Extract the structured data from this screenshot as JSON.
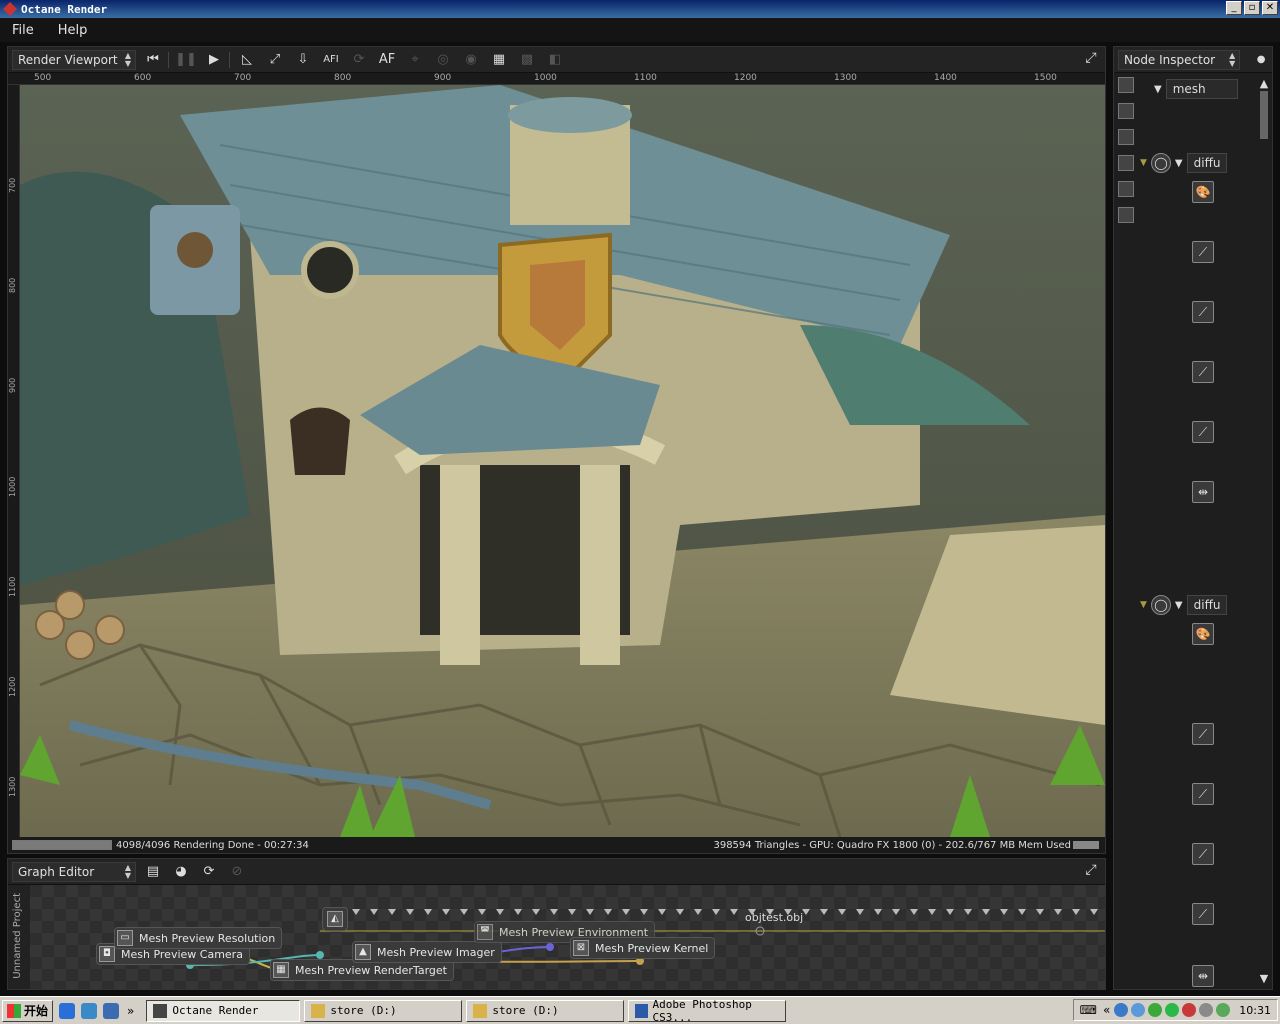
{
  "window": {
    "title": "Octane Render",
    "buttons": {
      "minimize": "_",
      "maximize": "▫",
      "close": "✕"
    }
  },
  "menubar": {
    "items": [
      "File",
      "Help"
    ]
  },
  "viewport": {
    "mode": "Render Viewport",
    "toolbar_af_label": "AF",
    "toolbar_afi_label": "AFI",
    "ruler_h": [
      "500",
      "600",
      "700",
      "800",
      "900",
      "1000",
      "1100",
      "1200",
      "1300",
      "1400",
      "1500"
    ],
    "ruler_v": [
      "700",
      "800",
      "900",
      "1000",
      "1100",
      "1200",
      "1300"
    ],
    "status_left": "4098/4096 Rendering Done - 00:27:34",
    "status_right": "398594 Triangles - GPU: Quadro FX 1800 (0) - 202.6/767 MB Mem Used",
    "progress": 1.0
  },
  "inspector": {
    "mode": "Node Inspector",
    "root_label": "mesh",
    "material_label_1": "diffu",
    "material_label_2": "diffu"
  },
  "graph": {
    "mode": "Graph Editor",
    "project_label": "Unnamed Project",
    "mesh_node": "objtest.obj",
    "nodes": {
      "resolution": "Mesh Preview Resolution",
      "camera": "Mesh Preview Camera",
      "rendertarget": "Mesh Preview RenderTarget",
      "imager": "Mesh Preview Imager",
      "environment": "Mesh Preview Environment",
      "kernel": "Mesh Preview Kernel"
    }
  },
  "taskbar": {
    "start_label": "开始",
    "ql_more": "»",
    "tasks": [
      "Octane Render",
      "store (D:)",
      "store (D:)",
      "Adobe Photoshop CS3..."
    ],
    "tray_chevron": "«",
    "clock": "10:31"
  },
  "colors": {
    "title_bar": "#0a246a",
    "panel_bg": "#1e1e1e",
    "render_base": "#4e5040"
  }
}
